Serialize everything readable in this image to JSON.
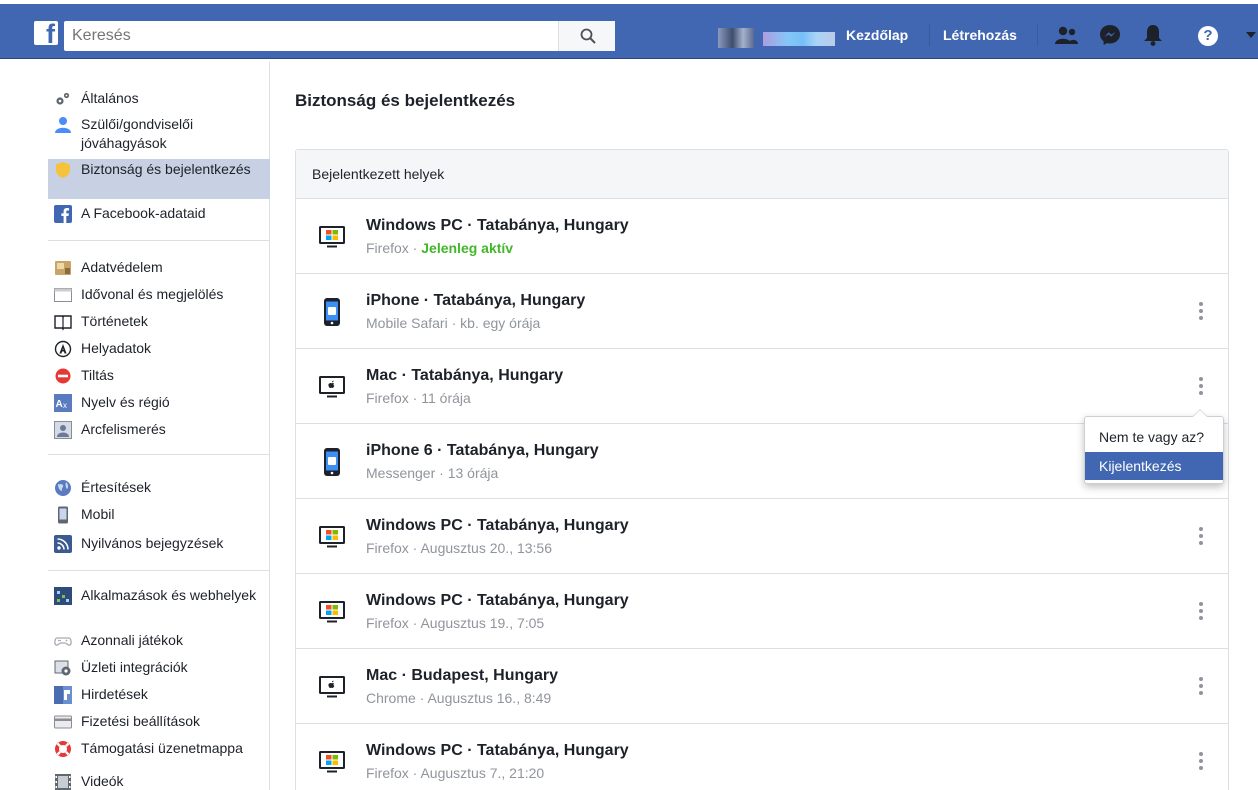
{
  "topbar": {
    "logo": "f",
    "search_placeholder": "Keresés",
    "nav": [
      "Kezdőlap",
      "Létrehozás"
    ],
    "help": "?"
  },
  "sidebar": {
    "groups": [
      [
        {
          "label": "Általános",
          "icon": "gears-icon"
        },
        {
          "label": "Szülői/gondviselői jóváhagyások",
          "icon": "person-icon"
        },
        {
          "label": "Biztonság és bejelentkezés",
          "icon": "shield-icon",
          "active": true
        },
        {
          "label": "A Facebook-adataid",
          "icon": "facebook-icon"
        }
      ],
      [
        {
          "label": "Adatvédelem",
          "icon": "lock-icon"
        },
        {
          "label": "Idővonal és megjelölés",
          "icon": "timeline-icon"
        },
        {
          "label": "Történetek",
          "icon": "book-icon"
        },
        {
          "label": "Helyadatok",
          "icon": "location-icon"
        },
        {
          "label": "Tiltás",
          "icon": "block-icon"
        },
        {
          "label": "Nyelv és régió",
          "icon": "language-icon"
        },
        {
          "label": "Arcfelismerés",
          "icon": "face-icon"
        }
      ],
      [
        {
          "label": "Értesítések",
          "icon": "globe-icon"
        },
        {
          "label": "Mobil",
          "icon": "mobile-icon"
        },
        {
          "label": "Nyilvános bejegyzések",
          "icon": "rss-icon"
        }
      ],
      [
        {
          "label": "Alkalmazások és webhelyek",
          "icon": "apps-icon"
        },
        {
          "label": "Azonnali játékok",
          "icon": "gamepad-icon"
        },
        {
          "label": "Üzleti integrációk",
          "icon": "business-icon"
        },
        {
          "label": "Hirdetések",
          "icon": "ads-icon"
        },
        {
          "label": "Fizetési beállítások",
          "icon": "card-icon"
        },
        {
          "label": "Támogatási üzenetmappa",
          "icon": "support-icon"
        },
        {
          "label": "Videók",
          "icon": "video-icon"
        }
      ]
    ]
  },
  "main": {
    "title": "Biztonság és bejelentkezés",
    "panel_title": "Bejelentkezett helyek",
    "sessions": [
      {
        "device": "Windows PC",
        "location": "Tatabánya, Hungary",
        "title": "Windows PC · Tatabánya, Hungary",
        "app": "Firefox",
        "time": "Jelenleg aktív",
        "active": true,
        "icon": "windows-pc-icon"
      },
      {
        "device": "iPhone",
        "location": "Tatabánya, Hungary",
        "title": "iPhone · Tatabánya, Hungary",
        "app": "Mobile Safari",
        "time": "kb. egy órája",
        "icon": "iphone-icon"
      },
      {
        "device": "Mac",
        "location": "Tatabánya, Hungary",
        "title": "Mac · Tatabánya, Hungary",
        "app": "Firefox",
        "time": "11 órája",
        "icon": "mac-icon"
      },
      {
        "device": "iPhone 6",
        "location": "Tatabánya, Hungary",
        "title": "iPhone 6 · Tatabánya, Hungary",
        "app": "Messenger",
        "time": "13 órája",
        "icon": "iphone-icon"
      },
      {
        "device": "Windows PC",
        "location": "Tatabánya, Hungary",
        "title": "Windows PC · Tatabánya, Hungary",
        "app": "Firefox",
        "time": "Augusztus 20., 13:56",
        "icon": "windows-pc-icon"
      },
      {
        "device": "Windows PC",
        "location": "Tatabánya, Hungary",
        "title": "Windows PC · Tatabánya, Hungary",
        "app": "Firefox",
        "time": "Augusztus 19., 7:05",
        "icon": "windows-pc-icon"
      },
      {
        "device": "Mac",
        "location": "Budapest, Hungary",
        "title": "Mac · Budapest, Hungary",
        "app": "Chrome",
        "time": "Augusztus 16., 8:49",
        "icon": "mac-icon"
      },
      {
        "device": "Windows PC",
        "location": "Tatabánya, Hungary",
        "title": "Windows PC · Tatabánya, Hungary",
        "app": "Firefox",
        "time": "Augusztus 7., 21:20",
        "icon": "windows-pc-icon"
      }
    ],
    "dropdown": {
      "items": [
        "Nem te vagy az?",
        "Kijelentkezés"
      ],
      "highlighted": "Kijelentkezés"
    }
  },
  "colors": {
    "brand": "#4267b2",
    "active_green": "#42b72a",
    "muted": "#90949c",
    "sidebar_active": "#c7d1e3"
  }
}
